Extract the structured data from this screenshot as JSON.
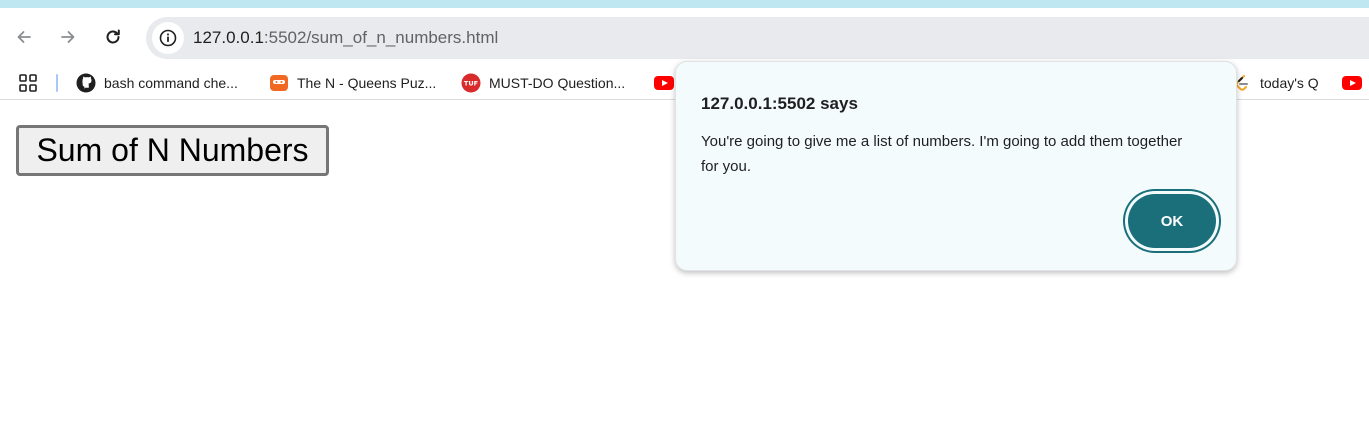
{
  "browser": {
    "url_host": "127.0.0.1",
    "url_rest": ":5502/sum_of_n_numbers.html",
    "icons": {
      "back": "arrow-left-icon",
      "forward": "arrow-right-icon",
      "reload": "reload-icon",
      "site_info": "info-icon"
    }
  },
  "bookmarks": [
    {
      "label": "bash command che...",
      "icon": "github-icon"
    },
    {
      "label": "The N - Queens Puz...",
      "icon": "codingninjas-icon"
    },
    {
      "label": "MUST-DO Question...",
      "icon": "tuf-icon"
    },
    {
      "label": "",
      "icon": "youtube-icon"
    },
    {
      "label": "today's Q",
      "icon": "leetcode-icon"
    },
    {
      "label": "",
      "icon": "youtube-icon"
    }
  ],
  "page": {
    "button_label": "Sum of N Numbers"
  },
  "dialog": {
    "title": "127.0.0.1:5502 says",
    "message": "You're going to give me a list of numbers. I'm going to add them together for you.",
    "ok_label": "OK"
  },
  "colors": {
    "accent": "#1a6f7b",
    "dialog_bg": "#f4fbfd",
    "top_strip": "#bfe7f1"
  }
}
